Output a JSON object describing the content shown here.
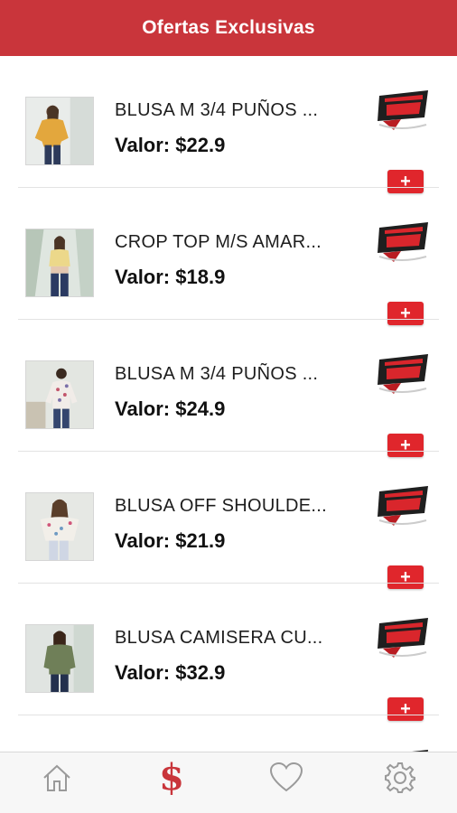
{
  "header": {
    "title": "Ofertas Exclusivas"
  },
  "products": [
    {
      "title": "BLUSA M 3/4 PUÑOS ...",
      "price": "Valor: $22.9",
      "add_label": "+",
      "image": "mustard-blouse-photo",
      "badge": "mega-sale-badge"
    },
    {
      "title": "CROP TOP M/S AMAR...",
      "price": "Valor: $18.9",
      "add_label": "+",
      "image": "yellow-crop-top-photo",
      "badge": "mega-sale-badge"
    },
    {
      "title": "BLUSA M 3/4 PUÑOS ...",
      "price": "Valor: $24.9",
      "add_label": "+",
      "image": "floral-blouse-photo",
      "badge": "mega-sale-badge"
    },
    {
      "title": "BLUSA OFF SHOULDE...",
      "price": "Valor: $21.9",
      "add_label": "+",
      "image": "off-shoulder-blouse-photo",
      "badge": "mega-sale-badge"
    },
    {
      "title": "BLUSA CAMISERA CU...",
      "price": "Valor: $32.9",
      "add_label": "+",
      "image": "green-shirt-blouse-photo",
      "badge": "mega-sale-badge"
    }
  ],
  "tabbar": {
    "items": [
      {
        "icon": "home-icon",
        "active": false
      },
      {
        "icon": "dollar-icon",
        "glyph": "$",
        "active": true
      },
      {
        "icon": "heart-icon",
        "active": false
      },
      {
        "icon": "gear-icon",
        "active": false
      }
    ]
  },
  "colors": {
    "header": "#c9353b",
    "button": "#e0262c",
    "active_tab": "#c9353b",
    "inactive_tab": "#9a9a9a"
  }
}
